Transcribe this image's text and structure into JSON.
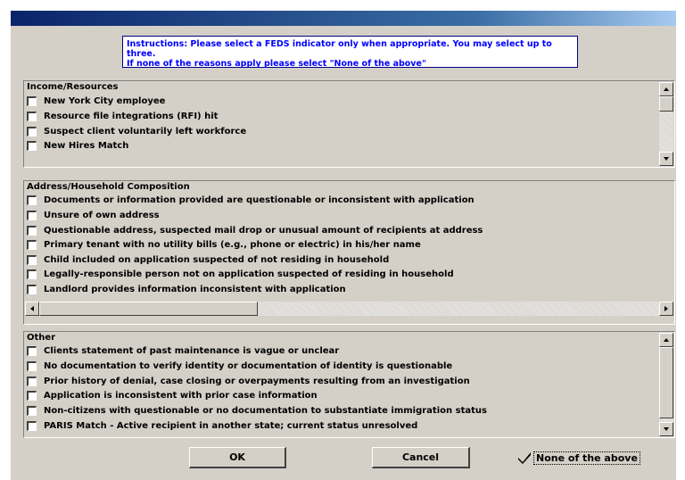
{
  "instructions": {
    "line1": "Instructions: Please select a FEDS indicator only when appropriate. You may select up to three.",
    "line2": "If none of the reasons apply please select \"None of the above\""
  },
  "groups": {
    "income": {
      "title": "Income/Resources",
      "items": [
        "New York City employee",
        "Resource file integrations (RFI) hit",
        "Suspect client voluntarily left workforce",
        "New Hires Match"
      ]
    },
    "address": {
      "title": "Address/Household Composition",
      "items": [
        "Documents or information provided are questionable or inconsistent with application",
        "Unsure of own address",
        "Questionable address, suspected mail drop or unusual amount of recipients at address",
        "Primary tenant with no utility bills (e.g., phone or electric) in his/her name",
        "Child included on application suspected of not residing in household",
        "Legally-responsible person not on application suspected of residing in household",
        "Landlord provides information inconsistent with application"
      ]
    },
    "other": {
      "title": "Other",
      "items": [
        "Clients statement of past maintenance is vague or unclear",
        "No documentation to verify identity or documentation of identity is questionable",
        "Prior history of denial, case closing or overpayments resulting from an investigation",
        "Application is inconsistent with prior case information",
        "Non-citizens with questionable or no documentation to substantiate immigration status",
        "PARIS Match - Active recipient in another state; current status unresolved"
      ]
    }
  },
  "buttons": {
    "ok": "OK",
    "cancel": "Cancel"
  },
  "none_of_above": {
    "label": "None of the above",
    "checked": true
  }
}
